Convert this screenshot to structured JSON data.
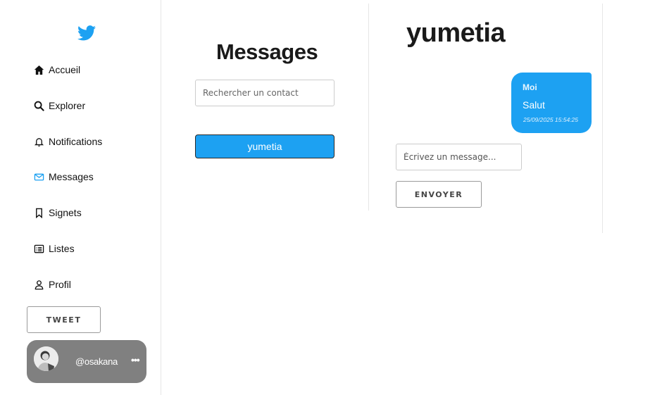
{
  "colors": {
    "accent": "#1da1f2",
    "profile_card": "#808080"
  },
  "sidebar": {
    "logo_icon": "twitter-bird-icon",
    "items": [
      {
        "label": "Accueil",
        "icon": "home-icon"
      },
      {
        "label": "Explorer",
        "icon": "search-icon"
      },
      {
        "label": "Notifications",
        "icon": "bell-icon"
      },
      {
        "label": "Messages",
        "icon": "envelope-icon"
      },
      {
        "label": "Signets",
        "icon": "bookmark-icon"
      },
      {
        "label": "Listes",
        "icon": "list-icon"
      },
      {
        "label": "Profil",
        "icon": "user-icon"
      }
    ],
    "tweet_label": "TWEET",
    "profile": {
      "handle": "@osakana",
      "more_label": "•••"
    }
  },
  "messages": {
    "title": "Messages",
    "search_placeholder": "Rechercher un contact",
    "contacts": [
      {
        "name": "yumetia"
      }
    ]
  },
  "chat": {
    "title": "yumetia",
    "messages": [
      {
        "sender": "Moi",
        "text": "Salut",
        "timestamp": "25/09/2025 15:54:25"
      }
    ],
    "input_placeholder": "Écrivez un message...",
    "send_label": "ENVOYER"
  }
}
